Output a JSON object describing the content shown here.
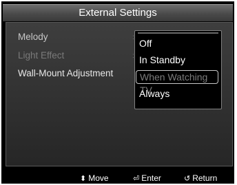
{
  "header": {
    "title": "External Settings"
  },
  "menu": {
    "items": [
      {
        "label": "Melody",
        "state": "selected"
      },
      {
        "label": "Light Effect",
        "state": "disabled"
      },
      {
        "label": "Wall-Mount Adjustment",
        "state": "normal"
      }
    ]
  },
  "dropdown": {
    "options": [
      "Off",
      "In Standby",
      "When Watching TV",
      "Always"
    ],
    "highlighted": "When Watching TV"
  },
  "footer": {
    "move_label": "Move",
    "enter_label": "Enter",
    "return_label": "Return",
    "move_icon": "up-down-arrows-icon",
    "enter_icon": "enter-icon",
    "return_icon": "return-icon"
  }
}
